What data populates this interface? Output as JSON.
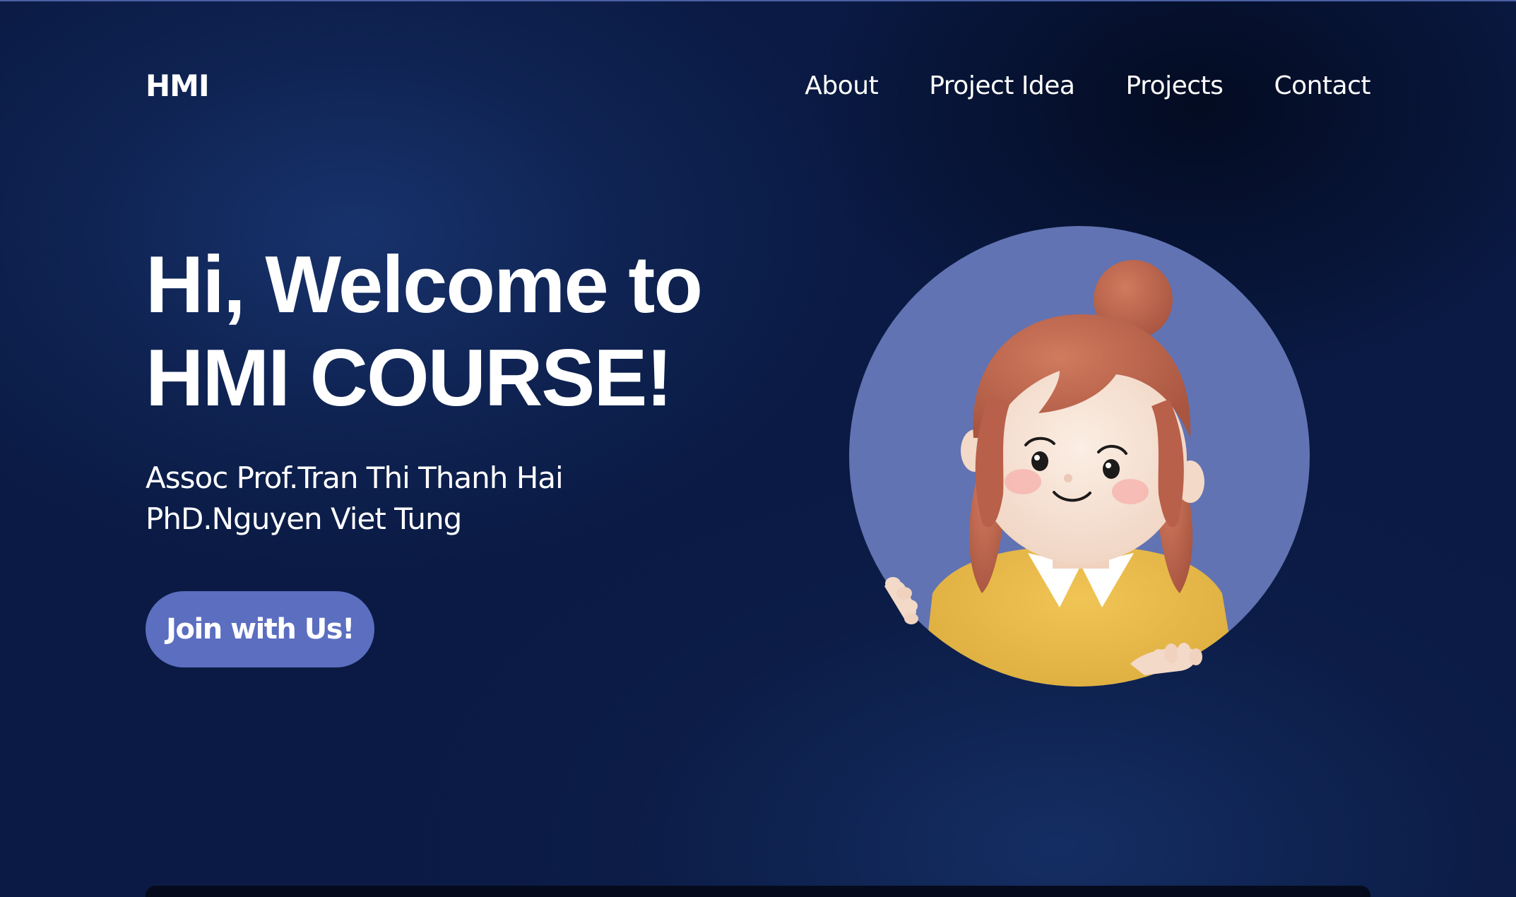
{
  "brand": "HMI",
  "nav": {
    "items": [
      {
        "label": "About"
      },
      {
        "label": "Project Idea"
      },
      {
        "label": "Projects"
      },
      {
        "label": "Contact"
      }
    ]
  },
  "hero": {
    "title_line1": "Hi, Welcome to",
    "title_line2": "HMI COURSE!",
    "instructors": [
      "Assoc Prof.Tran Thi Thanh Hai",
      "PhD.Nguyen Viet Tung"
    ],
    "cta_label": "Join with Us!"
  },
  "colors": {
    "background": "#0a1a44",
    "accent": "#5b6ec0",
    "avatar_circle": "#6173b2",
    "text": "#ffffff"
  },
  "icons": {
    "avatar": "cartoon-girl-avatar"
  }
}
